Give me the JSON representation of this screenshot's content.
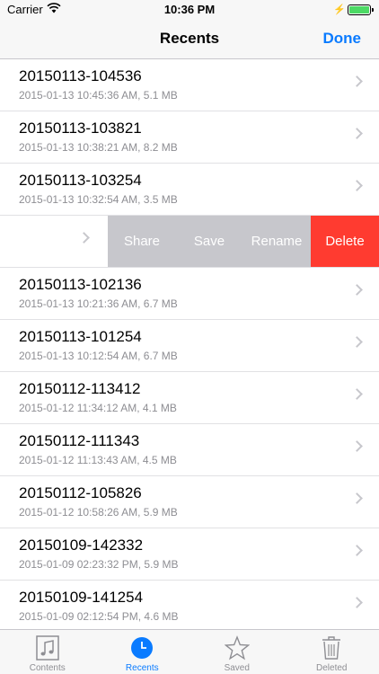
{
  "status_bar": {
    "carrier": "Carrier",
    "time": "10:36 PM",
    "battery_level": 1.0
  },
  "nav": {
    "title": "Recents",
    "done_label": "Done"
  },
  "rows": [
    {
      "title": "20150113-104536",
      "subtitle": "2015-01-13 10:45:36 AM, 5.1 MB"
    },
    {
      "title": "20150113-103821",
      "subtitle": "2015-01-13 10:38:21 AM, 8.2 MB"
    },
    {
      "title": "20150113-103254",
      "subtitle": "2015-01-13 10:32:54 AM, 3.5 MB"
    },
    {
      "title": "20150113-102136",
      "subtitle": "2015-01-13 10:21:36 AM, 6.7 MB"
    },
    {
      "title": "20150113-101254",
      "subtitle": "2015-01-13 10:12:54 AM, 6.7 MB"
    },
    {
      "title": "20150112-113412",
      "subtitle": "2015-01-12 11:34:12 AM, 4.1 MB"
    },
    {
      "title": "20150112-111343",
      "subtitle": "2015-01-12 11:13:43 AM, 4.5 MB"
    },
    {
      "title": "20150112-105826",
      "subtitle": "2015-01-12 10:58:26 AM, 5.9 MB"
    },
    {
      "title": "20150109-142332",
      "subtitle": "2015-01-09 02:23:32 PM, 5.9 MB"
    },
    {
      "title": "20150109-141254",
      "subtitle": "2015-01-09 02:12:54 PM, 4.6 MB"
    }
  ],
  "swipe_actions": {
    "share": "Share",
    "save": "Save",
    "rename": "Rename",
    "delete": "Delete"
  },
  "tabs": [
    {
      "label": "Contents",
      "icon": "music-note-icon"
    },
    {
      "label": "Recents",
      "icon": "clock-icon"
    },
    {
      "label": "Saved",
      "icon": "star-icon"
    },
    {
      "label": "Deleted",
      "icon": "trash-icon"
    }
  ],
  "colors": {
    "accent": "#0a7bff",
    "delete": "#ff3b30",
    "action_gray": "#c7c7cc"
  }
}
